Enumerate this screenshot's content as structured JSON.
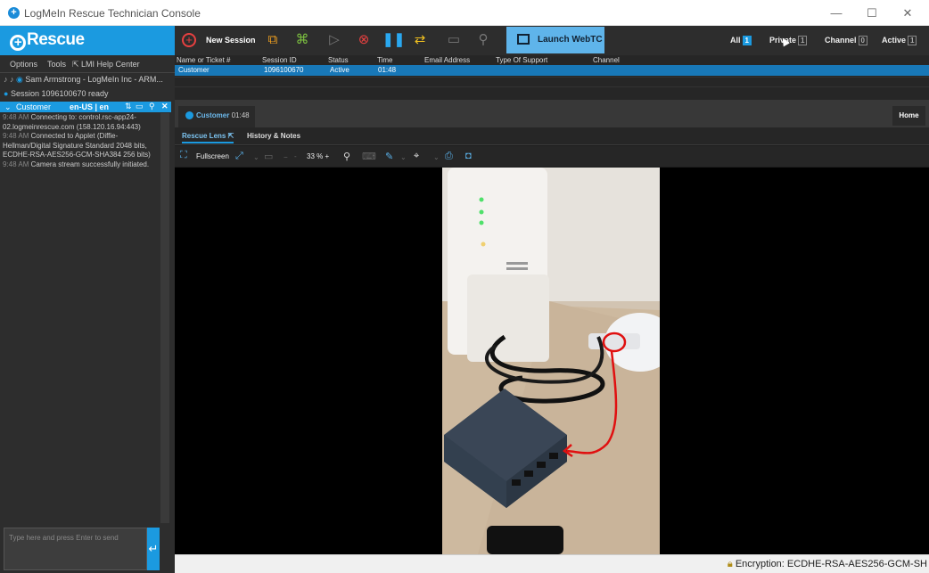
{
  "window": {
    "title": "LogMeIn Rescue Technician Console",
    "min": "—",
    "max": "☐",
    "close": "✕"
  },
  "logo": "Rescue",
  "menu": {
    "options": "Options",
    "tools": "Tools",
    "help": "LMI Help Center"
  },
  "sidebar": {
    "user": "Sam Armstrong - LogMeIn Inc - ARM...",
    "session_status": "Session 1096100670 ready",
    "customer_label": "Customer",
    "language": "en-US | en",
    "log": [
      {
        "ts": "9:48 AM",
        "text": "Connecting to: control.rsc-app24-02.logmeinrescue.com (158.120.16.94:443)"
      },
      {
        "ts": "9:48 AM",
        "text": "Connected to Applet (Diffie-Hellman/Digital Signature Standard 2048 bits, ECDHE-RSA-AES256-GCM-SHA384 256 bits)"
      },
      {
        "ts": "9:48 AM",
        "text": "Camera stream successfully initiated."
      }
    ],
    "chat_placeholder": "Type here and press Enter to send"
  },
  "toolbar": {
    "new_session": "New Session",
    "launch_webtc": "Launch WebTC"
  },
  "filters": [
    {
      "label": "All",
      "count": "1",
      "selected": true
    },
    {
      "label": "Private",
      "count": "1",
      "selected": false
    },
    {
      "label": "Channel",
      "count": "0",
      "selected": false
    },
    {
      "label": "Active",
      "count": "1",
      "selected": false
    }
  ],
  "grid": {
    "headers": [
      "Name or Ticket #",
      "Session ID",
      "Status",
      "Time",
      "Email Address",
      "Type Of Support",
      "Channel"
    ],
    "rows": [
      [
        "Customer",
        "1096100670",
        "Active",
        "01:48",
        "",
        "",
        ""
      ]
    ]
  },
  "session_tab": {
    "name": "Customer",
    "time": "01:48"
  },
  "home_tab": "Home",
  "subtabs": {
    "lens": "Rescue Lens",
    "history": "History & Notes"
  },
  "lens_toolbar": {
    "fullscreen": "Fullscreen",
    "zoom": "33",
    "zoom_unit": "%"
  },
  "status": {
    "encryption": "Encryption: ECDHE-RSA-AES256-GCM-SH"
  },
  "colors": {
    "accent": "#1b9ae0",
    "annotation": "#e01010"
  }
}
